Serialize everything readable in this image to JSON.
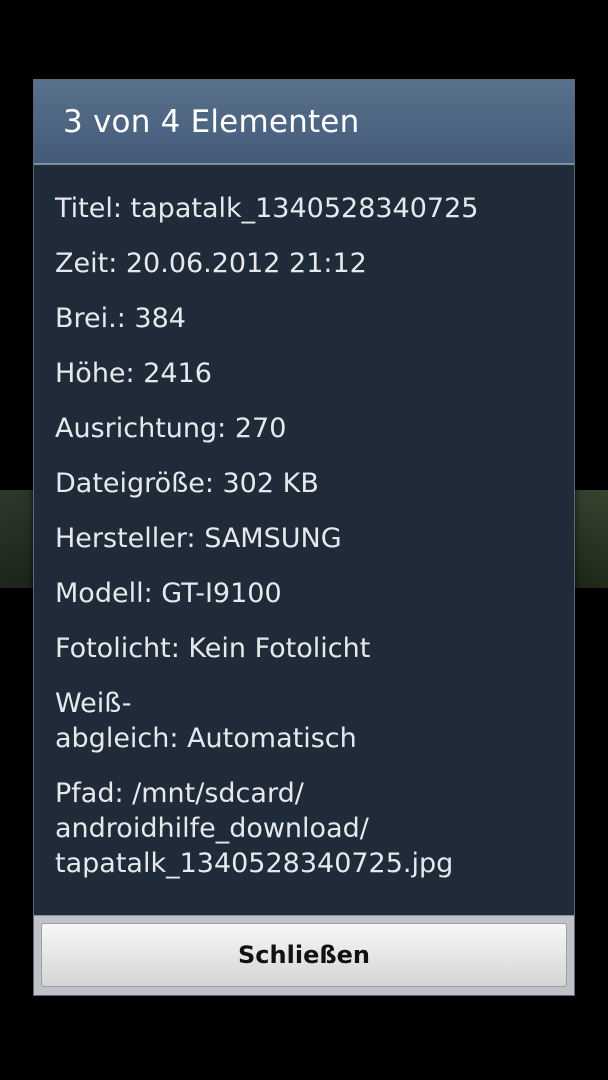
{
  "dialog": {
    "title": "3 von 4 Elementen",
    "details": [
      "Titel: tapatalk_1340528340725",
      "Zeit: 20.06.2012 21:12",
      "Brei.: 384",
      "Höhe: 2416",
      "Ausrichtung: 270",
      "Dateigröße: 302 KB",
      "Hersteller: SAMSUNG",
      "Modell: GT-I9100",
      "Fotolicht: Kein Fotolicht"
    ],
    "white_balance_line1": "Weiß-",
    "white_balance_line2": "abgleich: Automatisch",
    "path_line1": "Pfad: /mnt/sdcard/",
    "path_line2": "androidhilfe_download/",
    "path_line3": "tapatalk_1340528340725.jpg",
    "close_label": "Schließen"
  }
}
